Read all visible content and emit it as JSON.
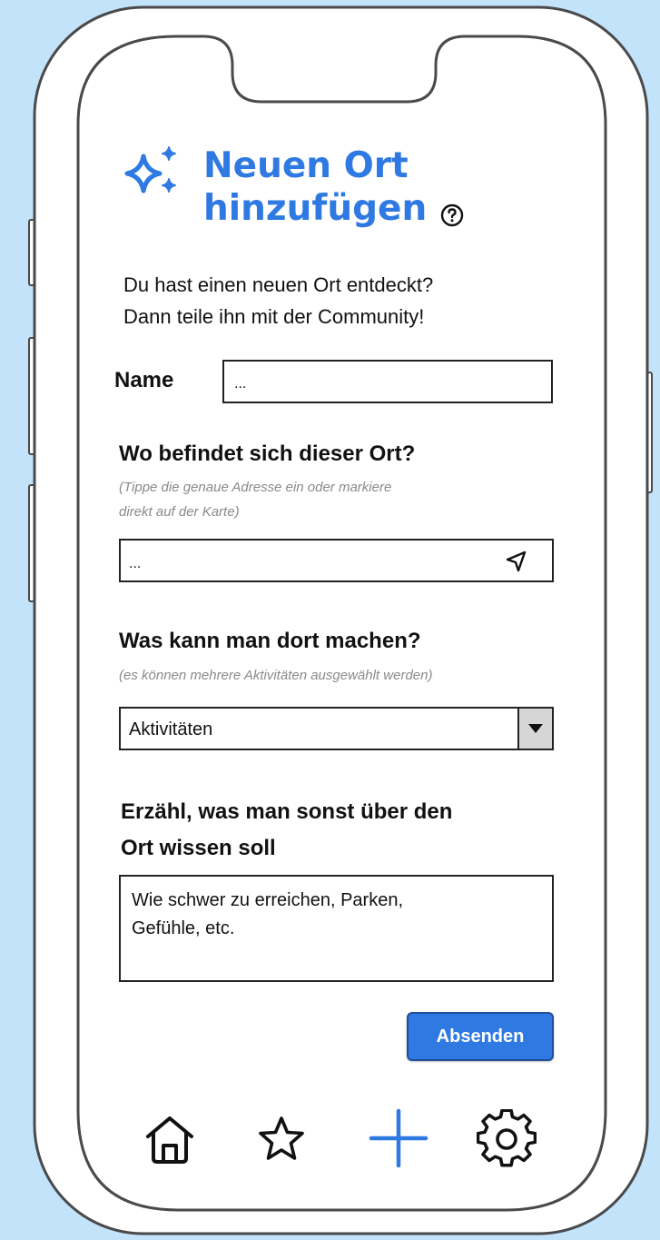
{
  "header": {
    "title_line1": "Neuen Ort",
    "title_line2": "hinzufügen",
    "title_icon": "sparkles-icon",
    "help_icon": "help-circle-icon"
  },
  "intro": {
    "line1": "Du hast einen neuen Ort entdeckt?",
    "line2": "Dann teile ihn mit der Community!"
  },
  "name_field": {
    "label": "Name",
    "placeholder": "..."
  },
  "location": {
    "heading": "Wo befindet sich dieser Ort?",
    "hint_line1": "(Tippe die genaue Adresse ein oder markiere",
    "hint_line2": "direkt auf der Karte)",
    "placeholder": "...",
    "locate_icon": "navigation-arrow-icon"
  },
  "activities": {
    "heading": "Was kann man dort machen?",
    "hint": "(es können mehrere Aktivitäten ausgewählt werden)",
    "selected": "Aktivitäten",
    "dropdown_icon": "chevron-down-icon"
  },
  "info": {
    "heading_line1": "Erzähl, was man sonst über den",
    "heading_line2": "Ort wissen soll",
    "placeholder_line1": "Wie schwer zu erreichen, Parken,",
    "placeholder_line2": "Gefühle, etc."
  },
  "submit_label": "Absenden",
  "tabbar": {
    "items": [
      {
        "icon": "home-icon"
      },
      {
        "icon": "star-icon"
      },
      {
        "icon": "plus-icon",
        "active": true
      },
      {
        "icon": "gear-icon"
      }
    ]
  },
  "colors": {
    "background": "#c3e3fb",
    "accent": "#2f79e3",
    "hint": "#8a8a8a"
  }
}
